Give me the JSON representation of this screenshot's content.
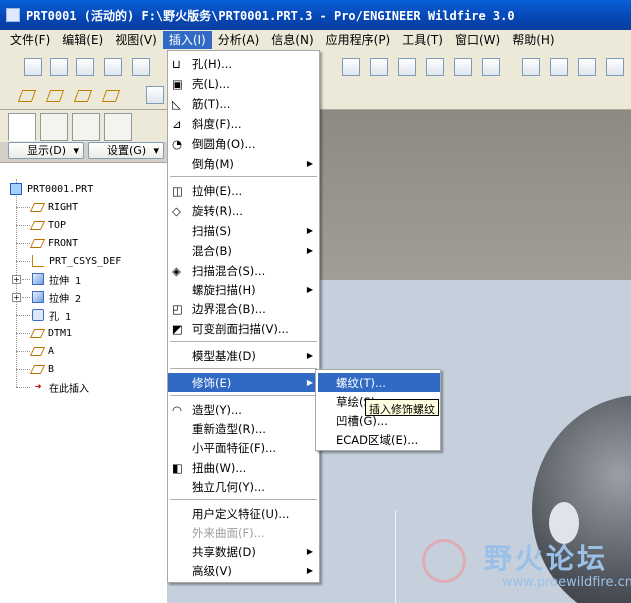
{
  "window": {
    "title": "PRT0001 (活动的) F:\\野火版务\\PRT0001.PRT.3 - Pro/ENGINEER Wildfire 3.0"
  },
  "menubar": {
    "items": [
      {
        "label": "文件(F)"
      },
      {
        "label": "编辑(E)"
      },
      {
        "label": "视图(V)"
      },
      {
        "label": "插入(I)"
      },
      {
        "label": "分析(A)"
      },
      {
        "label": "信息(N)"
      },
      {
        "label": "应用程序(P)"
      },
      {
        "label": "工具(T)"
      },
      {
        "label": "窗口(W)"
      },
      {
        "label": "帮助(H)"
      }
    ]
  },
  "left_panel": {
    "show_label": "显示(D)",
    "settings_label": "设置(G)"
  },
  "model_tree": {
    "nodes": [
      {
        "label": "PRT0001.PRT",
        "icon": "part-icon"
      },
      {
        "label": "RIGHT",
        "icon": "datum-plane-icon"
      },
      {
        "label": "TOP",
        "icon": "datum-plane-icon"
      },
      {
        "label": "FRONT",
        "icon": "datum-plane-icon"
      },
      {
        "label": "PRT_CSYS_DEF",
        "icon": "csys-icon"
      },
      {
        "label": "拉伸 1",
        "icon": "extrude-icon"
      },
      {
        "label": "拉伸 2",
        "icon": "extrude-icon"
      },
      {
        "label": "孔 1",
        "icon": "hole-icon"
      },
      {
        "label": "DTM1",
        "icon": "datum-plane-icon"
      },
      {
        "label": "A",
        "icon": "datum-plane-icon"
      },
      {
        "label": "B",
        "icon": "datum-plane-icon"
      },
      {
        "label": "在此插入",
        "icon": "insert-here-icon"
      }
    ]
  },
  "insert_menu": {
    "items": [
      {
        "label": "孔(H)..."
      },
      {
        "label": "壳(L)..."
      },
      {
        "label": "筋(T)..."
      },
      {
        "label": "斜度(F)..."
      },
      {
        "label": "倒圆角(O)..."
      },
      {
        "label": "倒角(M)"
      },
      {
        "label": "拉伸(E)..."
      },
      {
        "label": "旋转(R)..."
      },
      {
        "label": "扫描(S)"
      },
      {
        "label": "混合(B)"
      },
      {
        "label": "扫描混合(S)..."
      },
      {
        "label": "螺旋扫描(H)"
      },
      {
        "label": "边界混合(B)..."
      },
      {
        "label": "可变剖面扫描(V)..."
      },
      {
        "label": "模型基准(D)"
      },
      {
        "label": "修饰(E)"
      },
      {
        "label": "造型(Y)..."
      },
      {
        "label": "重新造型(R)..."
      },
      {
        "label": "小平面特征(F)..."
      },
      {
        "label": "扭曲(W)..."
      },
      {
        "label": "独立几何(Y)..."
      },
      {
        "label": "用户定义特征(U)..."
      },
      {
        "label": "外来曲面(F)..."
      },
      {
        "label": "共享数据(D)"
      },
      {
        "label": "高级(V)"
      }
    ]
  },
  "cosmetic_submenu": {
    "items": [
      {
        "label": "螺纹(T)..."
      },
      {
        "label": "草绘(S)..."
      },
      {
        "label": "凹槽(G)..."
      },
      {
        "label": "ECAD区域(E)..."
      }
    ]
  },
  "tooltip": {
    "text": "插入修饰螺纹"
  },
  "watermark": {
    "title": "野火论坛",
    "url": "www.proewildfire.cn"
  }
}
